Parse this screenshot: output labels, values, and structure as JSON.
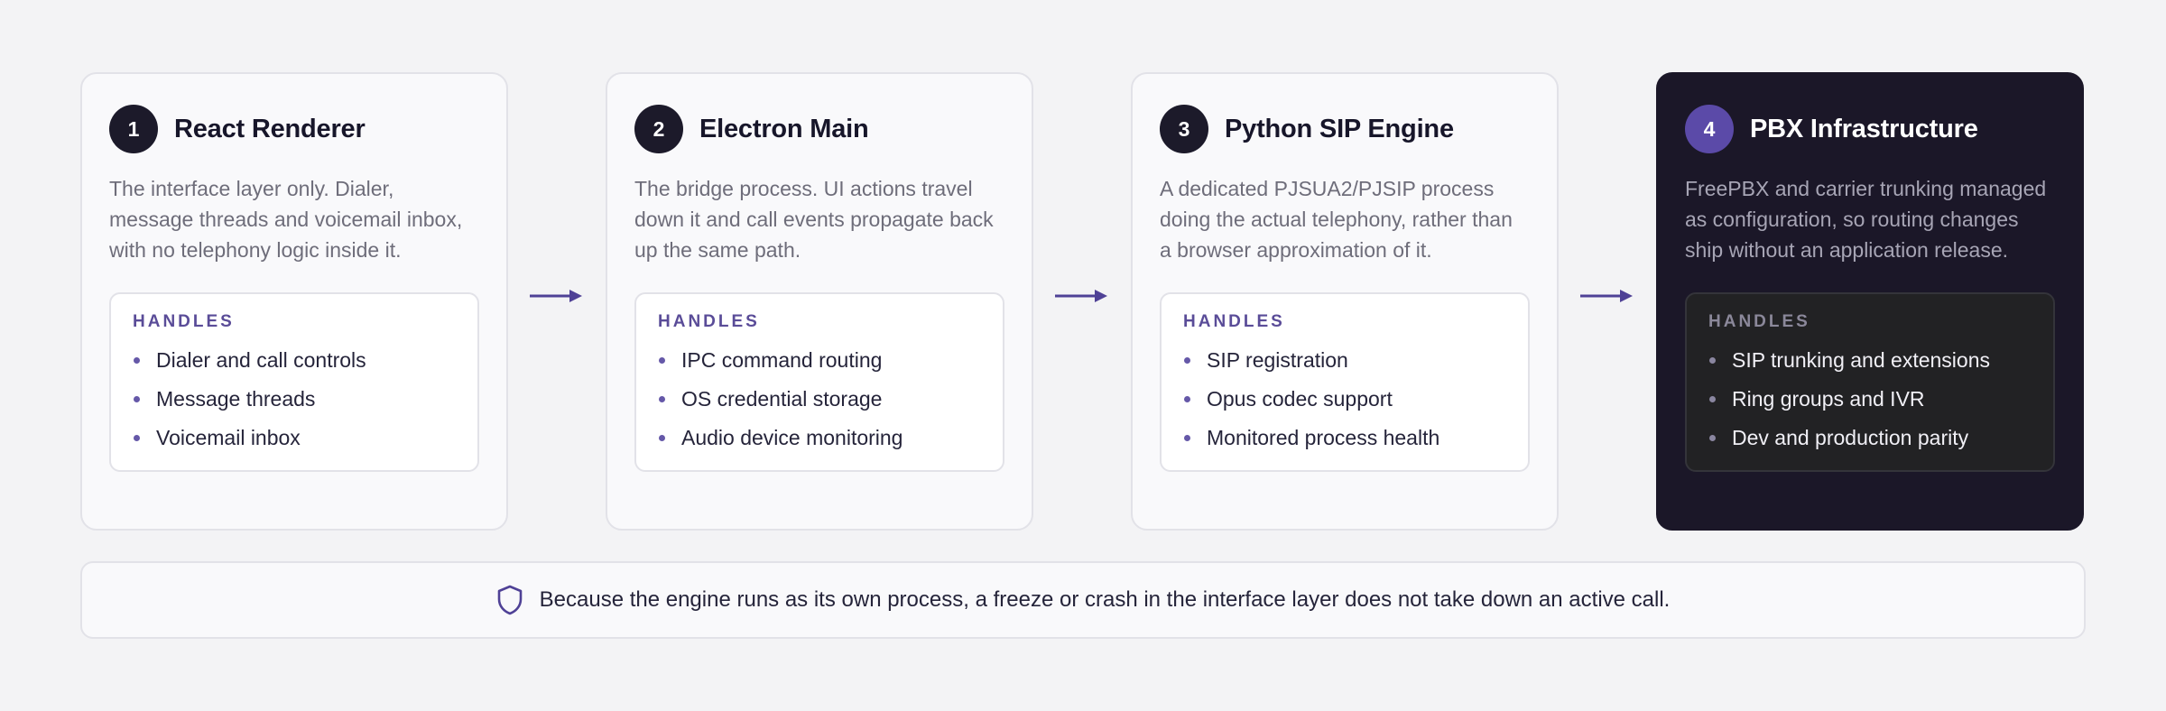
{
  "handles_label": "HANDLES",
  "stages": [
    {
      "number": "1",
      "title": "React Renderer",
      "description": "The interface layer only. Dialer, message threads and voicemail inbox, with no telephony logic inside it.",
      "handles": [
        "Dialer and call controls",
        "Message threads",
        "Voicemail inbox"
      ]
    },
    {
      "number": "2",
      "title": "Electron Main",
      "description": "The bridge process. UI actions travel down it and call events propagate back up the same path.",
      "handles": [
        "IPC command routing",
        "OS credential storage",
        "Audio device monitoring"
      ]
    },
    {
      "number": "3",
      "title": "Python SIP Engine",
      "description": "A dedicated PJSUA2/PJSIP process doing the actual telephony, rather than a browser approximation of it.",
      "handles": [
        "SIP registration",
        "Opus codec support",
        "Monitored process health"
      ]
    },
    {
      "number": "4",
      "title": "PBX Infrastructure",
      "description": "FreePBX and carrier trunking managed as configuration, so routing changes ship without an application release.",
      "handles": [
        "SIP trunking and extensions",
        "Ring groups and IVR",
        "Dev and production parity"
      ]
    }
  ],
  "note": {
    "icon": "shield-icon",
    "text": "Because the engine runs as its own process, a freeze or crash in the interface layer does not take down an active call."
  },
  "colors": {
    "accent": "#5b4aa8",
    "dark_card": "#1b1728",
    "arrow": "#4f4196"
  }
}
